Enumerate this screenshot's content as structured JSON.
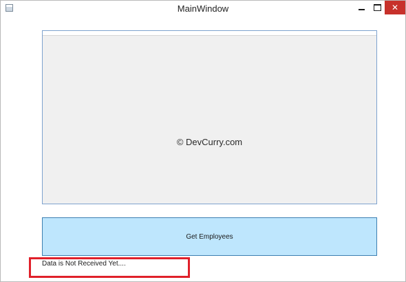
{
  "window": {
    "title": "MainWindow",
    "controls": {
      "minimize_icon": "minimize-icon",
      "maximize_icon": "maximize-icon",
      "close_icon": "close-icon",
      "close_glyph": "✕"
    }
  },
  "datagrid": {
    "watermark": "© DevCurry.com"
  },
  "actions": {
    "get_employees_label": "Get Employees"
  },
  "status": {
    "message": "Data is Not Received Yet...."
  },
  "colors": {
    "button_background": "#bee6fd",
    "button_border": "#3c7fb1",
    "highlight_border": "#e0202a",
    "close_button": "#c7312b"
  }
}
